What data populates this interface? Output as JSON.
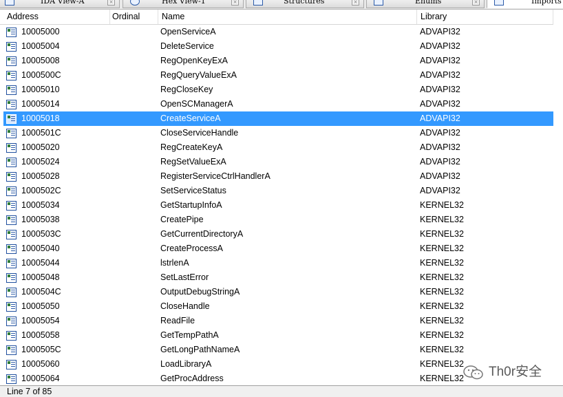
{
  "tabs": [
    {
      "label": "IDA View-A",
      "icon": "ida-view-icon",
      "active": false
    },
    {
      "label": "Hex View-1",
      "icon": "hex-view-icon",
      "active": false
    },
    {
      "label": "Structures",
      "icon": "structures-icon",
      "active": false
    },
    {
      "label": "Enums",
      "icon": "enums-icon",
      "active": false
    },
    {
      "label": "Imports",
      "icon": "imports-icon",
      "active": true
    }
  ],
  "columns": {
    "address": "Address",
    "ordinal": "Ordinal",
    "name": "Name",
    "library": "Library"
  },
  "rows": [
    {
      "address": "10005000",
      "ordinal": "",
      "name": "OpenServiceA",
      "library": "ADVAPI32"
    },
    {
      "address": "10005004",
      "ordinal": "",
      "name": "DeleteService",
      "library": "ADVAPI32"
    },
    {
      "address": "10005008",
      "ordinal": "",
      "name": "RegOpenKeyExA",
      "library": "ADVAPI32"
    },
    {
      "address": "1000500C",
      "ordinal": "",
      "name": "RegQueryValueExA",
      "library": "ADVAPI32"
    },
    {
      "address": "10005010",
      "ordinal": "",
      "name": "RegCloseKey",
      "library": "ADVAPI32"
    },
    {
      "address": "10005014",
      "ordinal": "",
      "name": "OpenSCManagerA",
      "library": "ADVAPI32"
    },
    {
      "address": "10005018",
      "ordinal": "",
      "name": "CreateServiceA",
      "library": "ADVAPI32",
      "selected": true
    },
    {
      "address": "1000501C",
      "ordinal": "",
      "name": "CloseServiceHandle",
      "library": "ADVAPI32"
    },
    {
      "address": "10005020",
      "ordinal": "",
      "name": "RegCreateKeyA",
      "library": "ADVAPI32"
    },
    {
      "address": "10005024",
      "ordinal": "",
      "name": "RegSetValueExA",
      "library": "ADVAPI32"
    },
    {
      "address": "10005028",
      "ordinal": "",
      "name": "RegisterServiceCtrlHandlerA",
      "library": "ADVAPI32"
    },
    {
      "address": "1000502C",
      "ordinal": "",
      "name": "SetServiceStatus",
      "library": "ADVAPI32"
    },
    {
      "address": "10005034",
      "ordinal": "",
      "name": "GetStartupInfoA",
      "library": "KERNEL32"
    },
    {
      "address": "10005038",
      "ordinal": "",
      "name": "CreatePipe",
      "library": "KERNEL32"
    },
    {
      "address": "1000503C",
      "ordinal": "",
      "name": "GetCurrentDirectoryA",
      "library": "KERNEL32"
    },
    {
      "address": "10005040",
      "ordinal": "",
      "name": "CreateProcessA",
      "library": "KERNEL32"
    },
    {
      "address": "10005044",
      "ordinal": "",
      "name": "lstrlenA",
      "library": "KERNEL32"
    },
    {
      "address": "10005048",
      "ordinal": "",
      "name": "SetLastError",
      "library": "KERNEL32"
    },
    {
      "address": "1000504C",
      "ordinal": "",
      "name": "OutputDebugStringA",
      "library": "KERNEL32"
    },
    {
      "address": "10005050",
      "ordinal": "",
      "name": "CloseHandle",
      "library": "KERNEL32"
    },
    {
      "address": "10005054",
      "ordinal": "",
      "name": "ReadFile",
      "library": "KERNEL32"
    },
    {
      "address": "10005058",
      "ordinal": "",
      "name": "GetTempPathA",
      "library": "KERNEL32"
    },
    {
      "address": "1000505C",
      "ordinal": "",
      "name": "GetLongPathNameA",
      "library": "KERNEL32"
    },
    {
      "address": "10005060",
      "ordinal": "",
      "name": "LoadLibraryA",
      "library": "KERNEL32"
    },
    {
      "address": "10005064",
      "ordinal": "",
      "name": "GetProcAddress",
      "library": "KERNEL32"
    }
  ],
  "row_icon": "import-entry-icon",
  "status": "Line 7 of 85",
  "watermark": {
    "text": "Th0r安全",
    "icon": "wechat-logo-icon"
  },
  "colors": {
    "selection": "#3399ff",
    "selection_text": "#ffffff",
    "icon_blue": "#1f4f9e"
  }
}
